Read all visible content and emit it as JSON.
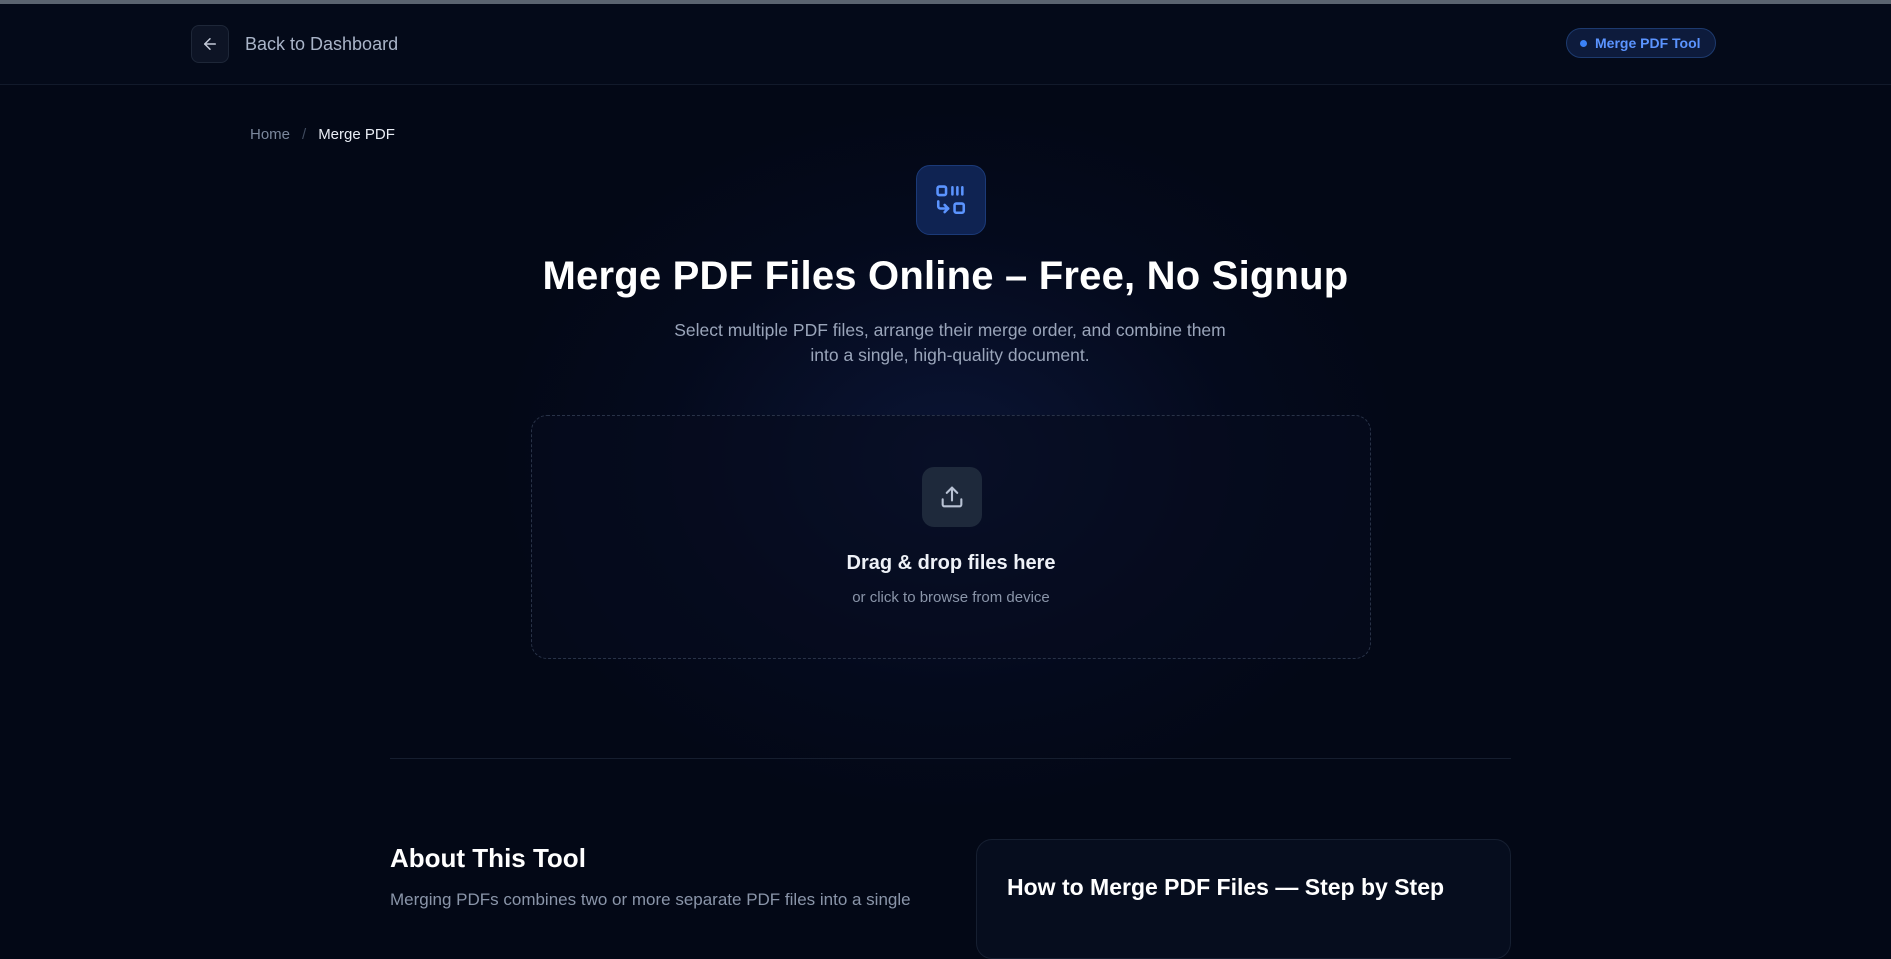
{
  "header": {
    "back_label": "Back to Dashboard",
    "badge_label": "Merge PDF Tool"
  },
  "breadcrumb": {
    "home": "Home",
    "separator": "/",
    "current": "Merge PDF"
  },
  "hero": {
    "title": "Merge PDF Files Online – Free, No Signup",
    "subtitle_line1": "Select multiple PDF files, arrange their merge order, and combine them",
    "subtitle_line2": "into a single, high-quality document."
  },
  "dropzone": {
    "title": "Drag & drop files here",
    "subtitle": "or click to browse from device"
  },
  "about": {
    "title": "About This Tool",
    "text_partial": "Merging PDFs combines two or more separate PDF files into a single"
  },
  "howto": {
    "title": "How to Merge PDF Files — Step by Step"
  },
  "colors": {
    "background": "#030816",
    "accent": "#3b82f6",
    "badge_text": "#5b94ff"
  }
}
